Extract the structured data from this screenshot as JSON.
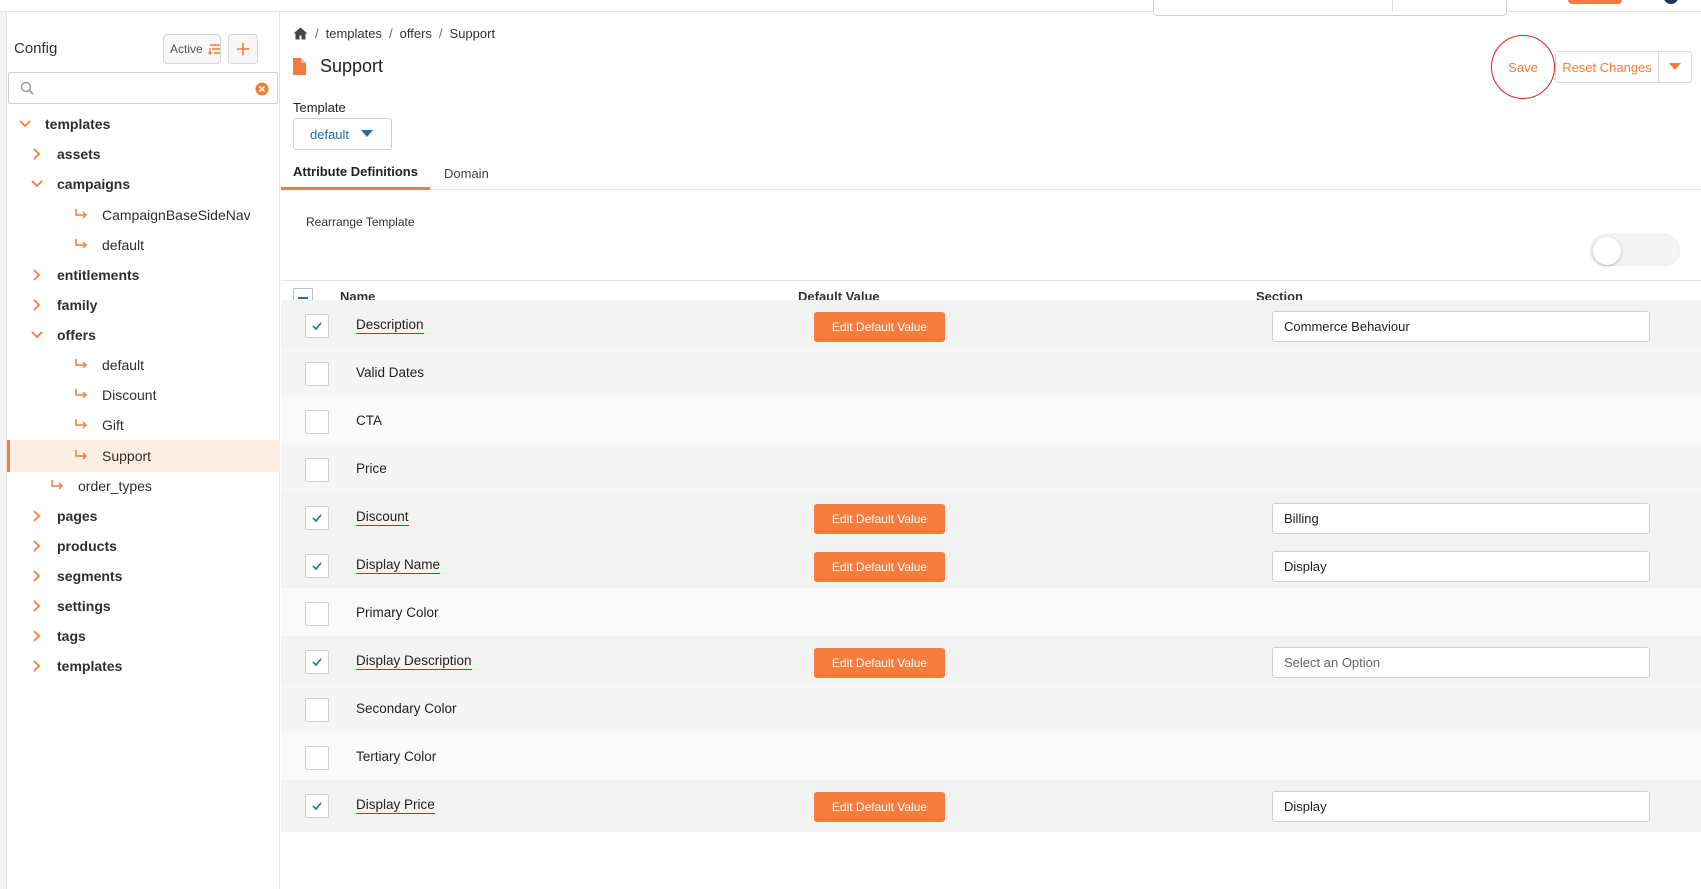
{
  "sidebar": {
    "title": "Config",
    "filter_button_label": "Active",
    "search": {
      "value": "",
      "placeholder": ""
    },
    "tree": [
      {
        "label": "templates",
        "level": 0,
        "expanded": true
      },
      {
        "label": "assets",
        "level": 1,
        "expanded": false
      },
      {
        "label": "campaigns",
        "level": 1,
        "expanded": true
      },
      {
        "label": "CampaignBaseSideNav",
        "level": 2,
        "leaf": true
      },
      {
        "label": "default",
        "level": 2,
        "leaf": true
      },
      {
        "label": "entitlements",
        "level": 1,
        "expanded": false
      },
      {
        "label": "family",
        "level": 1,
        "expanded": false
      },
      {
        "label": "offers",
        "level": 1,
        "expanded": true
      },
      {
        "label": "default",
        "level": 2,
        "leaf": true
      },
      {
        "label": "Discount",
        "level": 2,
        "leaf": true
      },
      {
        "label": "Gift",
        "level": 2,
        "leaf": true
      },
      {
        "label": "Support",
        "level": 2,
        "leaf": true,
        "selected": true
      },
      {
        "label": "order_types",
        "level": 1,
        "leaf": true
      },
      {
        "label": "pages",
        "level": 1,
        "expanded": false
      },
      {
        "label": "products",
        "level": 1,
        "expanded": false
      },
      {
        "label": "segments",
        "level": 1,
        "expanded": false
      },
      {
        "label": "settings",
        "level": 1,
        "expanded": false
      },
      {
        "label": "tags",
        "level": 1,
        "expanded": false
      },
      {
        "label": "templates",
        "level": 1,
        "expanded": false
      }
    ]
  },
  "breadcrumb": [
    "templates",
    "offers",
    "Support"
  ],
  "page_title": "Support",
  "actions": {
    "save": "Save",
    "reset": "Reset Changes"
  },
  "template": {
    "label": "Template",
    "value": "default"
  },
  "tabs": [
    "Attribute Definitions",
    "Domain"
  ],
  "rearrange_label": "Rearrange Template",
  "table": {
    "columns": [
      "Name",
      "Default Value",
      "Section"
    ],
    "edit_label": "Edit Default Value",
    "rows": [
      {
        "name": "Description",
        "checked": true,
        "section": "Commerce Behaviour"
      },
      {
        "name": "Valid Dates",
        "checked": false
      },
      {
        "name": "CTA",
        "checked": false
      },
      {
        "name": "Price",
        "checked": false
      },
      {
        "name": "Discount",
        "checked": true,
        "section": "Billing"
      },
      {
        "name": "Display Name",
        "checked": true,
        "section": "Display"
      },
      {
        "name": "Primary Color",
        "checked": false
      },
      {
        "name": "Display Description",
        "checked": true,
        "section": "Select an Option",
        "placeholder": true
      },
      {
        "name": "Secondary Color",
        "checked": false
      },
      {
        "name": "Tertiary Color",
        "checked": false
      },
      {
        "name": "Display Price",
        "checked": true,
        "section": "Display"
      }
    ]
  },
  "colors": {
    "accent": "#f47c3c",
    "highlight": "#e02020",
    "link": "#1a6fb5"
  }
}
